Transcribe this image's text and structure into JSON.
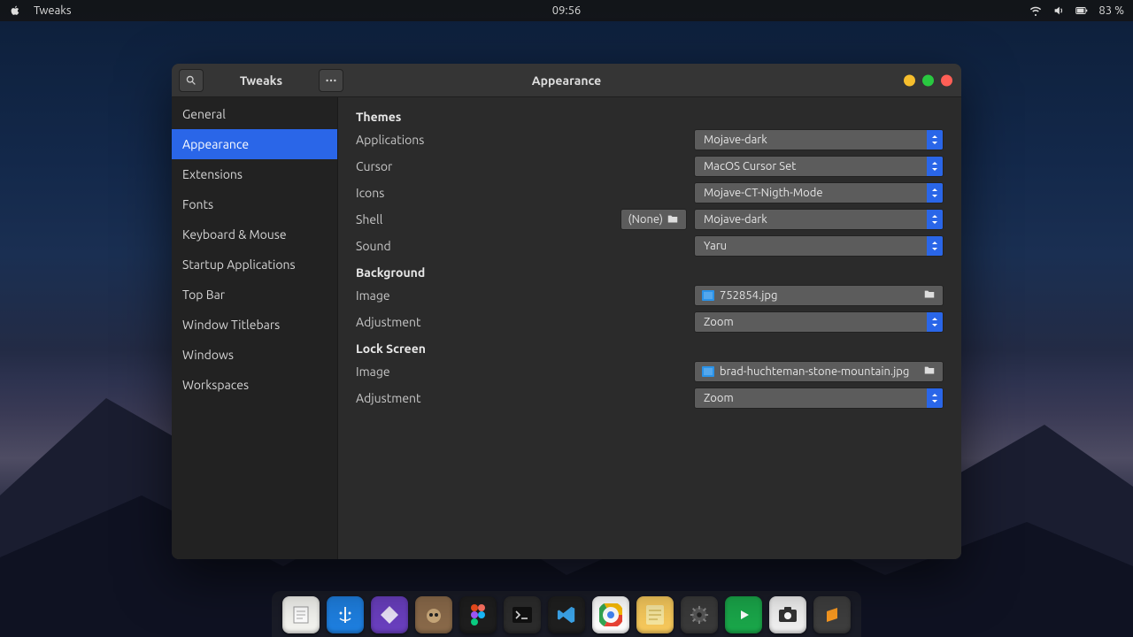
{
  "menubar": {
    "app_name": "Tweaks",
    "clock": "09:56",
    "battery": "83 %"
  },
  "window": {
    "title_left": "Tweaks",
    "title_center": "Appearance"
  },
  "sidebar": {
    "items": [
      {
        "label": "General"
      },
      {
        "label": "Appearance"
      },
      {
        "label": "Extensions"
      },
      {
        "label": "Fonts"
      },
      {
        "label": "Keyboard & Mouse"
      },
      {
        "label": "Startup Applications"
      },
      {
        "label": "Top Bar"
      },
      {
        "label": "Window Titlebars"
      },
      {
        "label": "Windows"
      },
      {
        "label": "Workspaces"
      }
    ],
    "active_index": 1
  },
  "themes": {
    "heading": "Themes",
    "applications": {
      "label": "Applications",
      "value": "Mojave-dark"
    },
    "cursor": {
      "label": "Cursor",
      "value": "MacOS Cursor Set"
    },
    "icons": {
      "label": "Icons",
      "value": "Mojave-CT-Nigth-Mode"
    },
    "shell": {
      "label": "Shell",
      "value": "Mojave-dark",
      "extra": "(None)"
    },
    "sound": {
      "label": "Sound",
      "value": "Yaru"
    }
  },
  "background": {
    "heading": "Background",
    "image": {
      "label": "Image",
      "file": "752854.jpg"
    },
    "adjustment": {
      "label": "Adjustment",
      "value": "Zoom"
    }
  },
  "lockscreen": {
    "heading": "Lock Screen",
    "image": {
      "label": "Image",
      "file": "brad-huchteman-stone-mountain.jpg"
    },
    "adjustment": {
      "label": "Adjustment",
      "value": "Zoom"
    }
  }
}
